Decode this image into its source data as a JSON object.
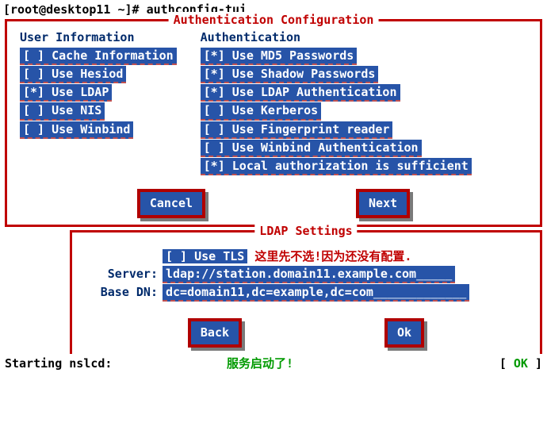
{
  "prompt": "[root@desktop11 ~]# authconfig-tui",
  "box1": {
    "title": "Authentication Configuration",
    "left": {
      "heading": "User Information",
      "items": [
        {
          "mark": " ",
          "label": "Cache Information"
        },
        {
          "mark": " ",
          "label": "Use Hesiod"
        },
        {
          "mark": "*",
          "label": "Use LDAP"
        },
        {
          "mark": " ",
          "label": "Use NIS"
        },
        {
          "mark": " ",
          "label": "Use Winbind"
        }
      ]
    },
    "right": {
      "heading": "Authentication",
      "items": [
        {
          "mark": "*",
          "label": "Use MD5 Passwords"
        },
        {
          "mark": "*",
          "label": "Use Shadow Passwords"
        },
        {
          "mark": "*",
          "label": "Use LDAP Authentication"
        },
        {
          "mark": " ",
          "label": "Use Kerberos"
        },
        {
          "mark": " ",
          "label": "Use Fingerprint reader"
        },
        {
          "mark": " ",
          "label": "Use Winbind Authentication"
        },
        {
          "mark": "*",
          "label": "Local authorization is sufficient"
        }
      ]
    },
    "cancel": "Cancel",
    "next": "Next"
  },
  "box2": {
    "title": "LDAP Settings",
    "tls": {
      "mark": " ",
      "label": "Use TLS"
    },
    "tls_note": "这里先不选!因为还没有配置.",
    "server_label": "Server:",
    "server_value": "ldap://station.domain11.example.com",
    "basedn_label": "Base DN:",
    "basedn_value": "dc=domain11,dc=example,dc=com",
    "back": "Back",
    "ok": "Ok"
  },
  "footer": {
    "left": "Starting nslcd:",
    "mid": "服务启动了!",
    "right_open": "[  ",
    "right_ok": "OK",
    "right_close": "  ]"
  }
}
